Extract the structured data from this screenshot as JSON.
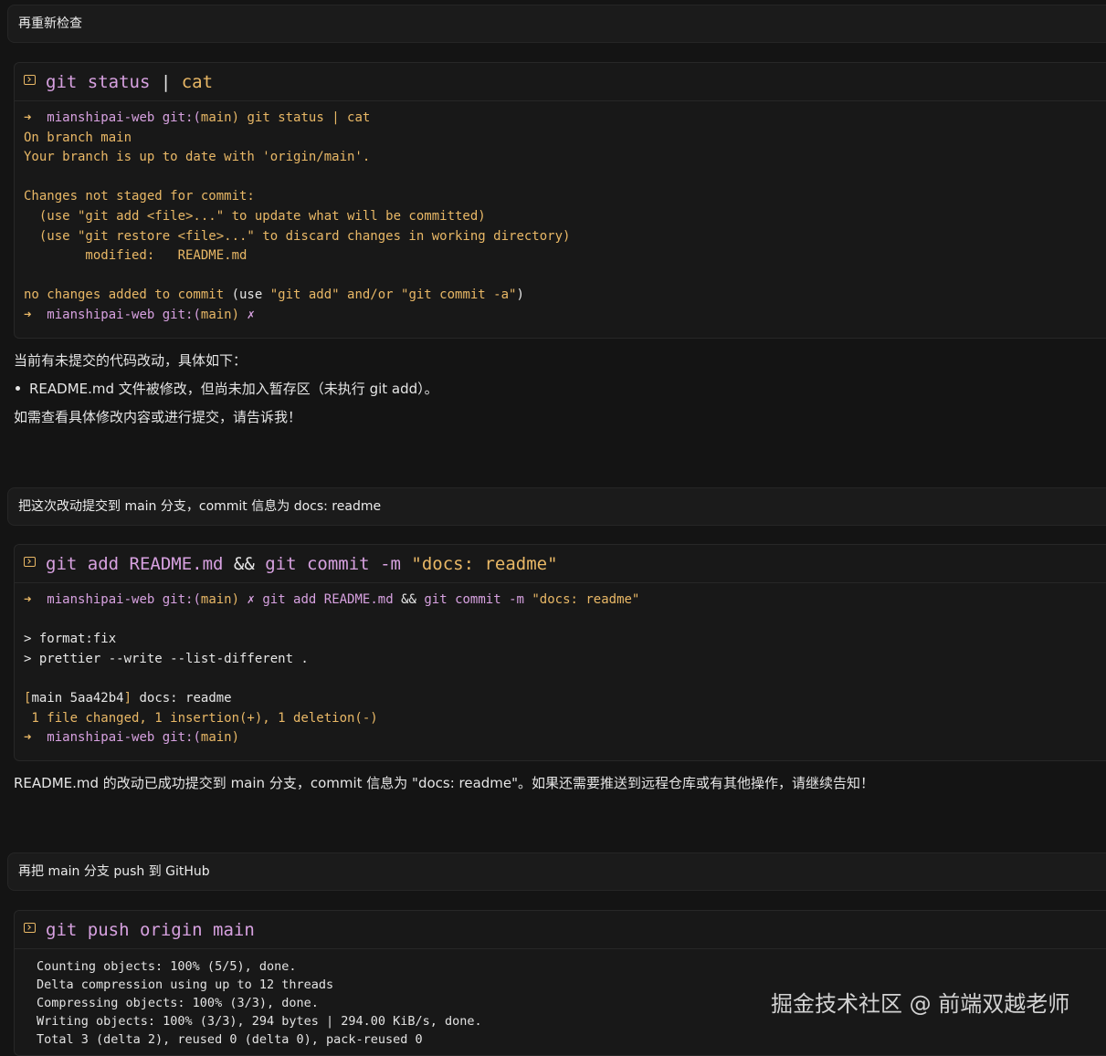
{
  "messages": {
    "m1": "再重新检查",
    "m2": "把这次改动提交到 main 分支，commit 信息为 docs: readme",
    "m3": "再把 main 分支 push 到 GitHub"
  },
  "term1": {
    "cmd_a": "git status",
    "cmd_pipe": " | ",
    "cmd_b": "cat",
    "l1": {
      "arrow": "➜  ",
      "dir": "mianshipai-web ",
      "git": "git:(",
      "branch": "main",
      "close": ")",
      "cmd": " git status | cat"
    },
    "l2": "On branch main",
    "l3": "Your branch is up to date with 'origin/main'.",
    "l5": "Changes not staged for commit:",
    "l6": "  (use \"git add <file>...\" to update what will be committed)",
    "l7": "  (use \"git restore <file>...\" to discard changes in working directory)",
    "l8": "        modified:   README.md",
    "l10a": "no changes added to commit ",
    "l10b": "(use ",
    "l10c": "\"git add\" and/or \"git commit -a\"",
    "l10d": ")",
    "l11": {
      "arrow": "➜  ",
      "dir": "mianshipai-web ",
      "git": "git:(",
      "branch": "main",
      "close": ")",
      "x": " ✗"
    }
  },
  "reply1": {
    "intro": "当前有未提交的代码改动，具体如下：",
    "bullet": "README.md 文件被修改，但尚未加入暂存区（未执行 git add）。",
    "outro": "如需查看具体修改内容或进行提交，请告诉我！"
  },
  "term2": {
    "cmd_a": "git add README.md",
    "cmd_and": " && ",
    "cmd_b": "git commit -m ",
    "cmd_c": "\"docs: readme\"",
    "l1": {
      "arrow": "➜  ",
      "dir": "mianshipai-web ",
      "git": "git:(",
      "branch": "main",
      "close": ")",
      "x": " ✗ ",
      "cmd_a": "git add README.md ",
      "and": "&&",
      "cmd_b": " git commit -m ",
      "msg": "\"docs: readme\""
    },
    "l3": "> format:fix",
    "l4": "> prettier --write --list-different .",
    "l6a": "[",
    "l6b": "main 5aa42b4",
    "l6c": "]",
    "l6d": " docs: readme",
    "l7": " 1 file changed, 1 insertion(+), 1 deletion(-)",
    "l8": {
      "arrow": "➜  ",
      "dir": "mianshipai-web ",
      "git": "git:(",
      "branch": "main",
      "close": ")"
    }
  },
  "reply2": "README.md 的改动已成功提交到 main 分支，commit 信息为 \"docs: readme\"。如果还需要推送到远程仓库或有其他操作，请继续告知！",
  "term3": {
    "cmd": "git push origin main",
    "lines": [
      "Counting objects: 100% (5/5), done.",
      "Delta compression using up to 12 threads",
      "Compressing objects: 100% (3/3), done.",
      "Writing objects: 100% (3/3), 294 bytes | 294.00 KiB/s, done.",
      "Total 3 (delta 2), reused 0 (delta 0), pack-reused 0"
    ]
  },
  "watermark": "掘金技术社区 @ 前端双越老师",
  "colors": {
    "accent_yellow": "#e9b866",
    "accent_purple": "#d7a1e0",
    "background": "#141414"
  }
}
